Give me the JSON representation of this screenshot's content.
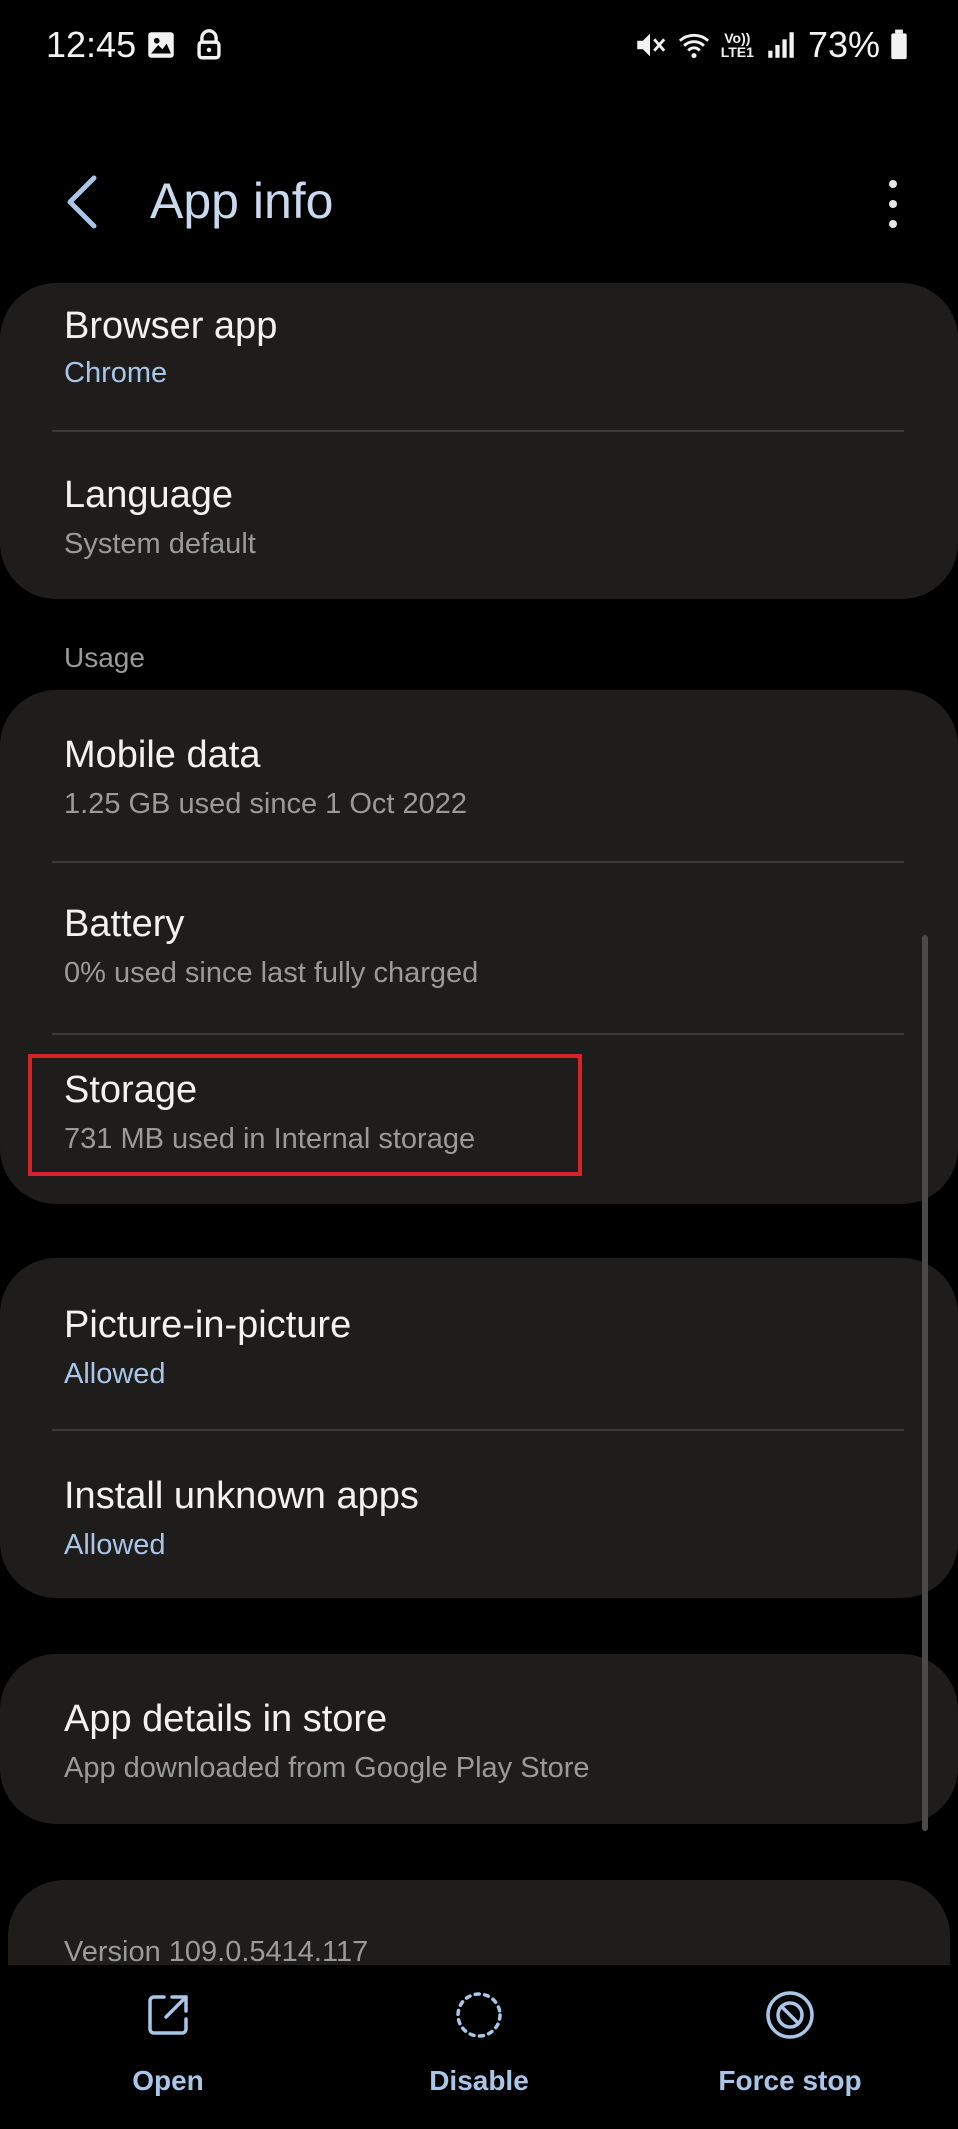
{
  "status_bar": {
    "time": "12:45",
    "battery_percent": "73%",
    "left_icons": [
      "gallery-icon",
      "lock-icon"
    ],
    "right_icons": [
      "mute-icon",
      "wifi-icon",
      "volte-icon",
      "signal-icon",
      "battery-icon"
    ],
    "volte_text_top": "Vo))",
    "volte_text_bottom": "LTE1"
  },
  "header": {
    "title": "App info",
    "back_icon": "chevron-left-icon",
    "more_icon": "more-vertical-icon"
  },
  "card_1": {
    "items": [
      {
        "title": "Browser app",
        "subtitle": "Chrome"
      },
      {
        "title": "Language",
        "subtitle": "System default"
      }
    ]
  },
  "usage_section": {
    "label": "Usage",
    "items": [
      {
        "title": "Mobile data",
        "subtitle": "1.25 GB used since 1 Oct 2022"
      },
      {
        "title": "Battery",
        "subtitle": "0% used since last fully charged"
      },
      {
        "title": "Storage",
        "subtitle": "731 MB used in Internal storage"
      }
    ]
  },
  "card_3": {
    "items": [
      {
        "title": "Picture-in-picture",
        "subtitle": "Allowed"
      },
      {
        "title": "Install unknown apps",
        "subtitle": "Allowed"
      }
    ]
  },
  "card_4": {
    "items": [
      {
        "title": "App details in store",
        "subtitle": "App downloaded from Google Play Store"
      }
    ]
  },
  "version": "Version 109.0.5414.117",
  "bottom_bar": {
    "buttons": [
      {
        "label": "Open",
        "icon": "open-external-icon"
      },
      {
        "label": "Disable",
        "icon": "disable-dotted-circle-icon"
      },
      {
        "label": "Force stop",
        "icon": "force-stop-icon"
      }
    ]
  },
  "colors": {
    "accent": "#a9c5e8",
    "title": "#c9d9ee",
    "card_bg": "#1e1d1b",
    "highlight": "#d6232a"
  }
}
